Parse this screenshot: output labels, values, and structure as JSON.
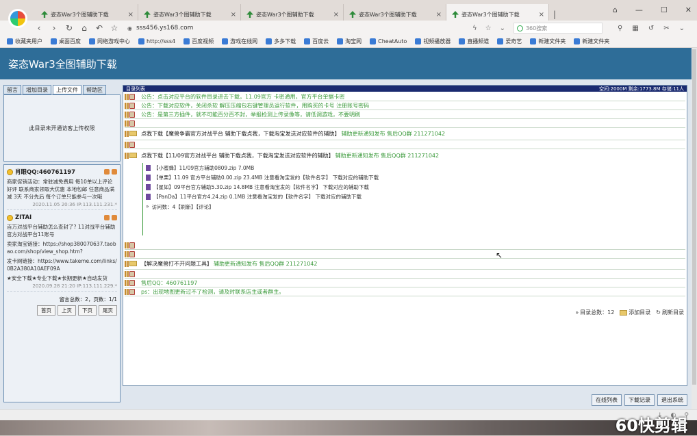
{
  "tabs": [
    {
      "label": "姿态War3个图辅助下载",
      "active": false
    },
    {
      "label": "姿态War3个图辅助下载",
      "active": false
    },
    {
      "label": "姿态War3个图辅助下载",
      "active": false
    },
    {
      "label": "姿态War3个图辅助下载",
      "active": false
    },
    {
      "label": "姿态War3个图辅助下载",
      "active": true
    }
  ],
  "url": "sss456.ys168.com",
  "search_engine": "360搜索",
  "bookmarks": [
    "收藏夹用户",
    "桌面百度",
    "网络游戏中心",
    "http://sss4",
    "百度视频",
    "游戏在线网",
    "多多下载",
    "百度云",
    "淘宝网",
    "CheatAuto",
    "视频播放器",
    "直播频道",
    "爱奇艺",
    "新建文件夹",
    "新建文件夹"
  ],
  "site_title": "姿态War3全图辅助下载",
  "left_tabs": [
    "留言",
    "增加目录",
    "上传文件",
    "帮助区"
  ],
  "no_upload_msg": "此目录未开通访客上传权限",
  "messages": [
    {
      "user": "肖眼QQ:460761197",
      "body": "商家促销活动：常驻减免费用 每10单以上评论好评 联系商家领取大优惠 本地包邮 任意商品满减 3天 不分先后 每个订单只能参与一次哦",
      "time": "2020.11.05 20:36 IP:113.111.231.*"
    },
    {
      "user": "ZITAI",
      "body": "百万对战平台辅助怎么查封了? 11对战平台辅助官方对战平台11账号",
      "sub": "卖家淘宝链接：https://shop380070637.taobao.com/shop/view_shop.htm?",
      "sub2": "发卡网链接：https://www.takeme.com/links/0B2A380A10AEF09A",
      "foot": "★安全下载★专业下载★长期更新★自动发货",
      "time": "2020.09.28 21:20 IP:113.111.229.*"
    }
  ],
  "pager": {
    "info": "留言总数：2，页数：1/1",
    "buttons": [
      "首页",
      "上页",
      "下页",
      "尾页"
    ]
  },
  "main_title": "目录列表",
  "quota": "空间:2000M 剩余:1773.8M 存储:11人",
  "notices": [
    "公告：点击对应平台的软件目录进去下载，11.09官方 卡密通用，官方平台单据卡密",
    "公告：下载对应软件，关闭杀软 解压压缩包右键管理员运行软件，用购买的卡号 注册账号密码",
    "公告：是第三方插件，就不可能百分百不封，举报检测上传录像等，请低调游戏，不要明刷"
  ],
  "folder1": {
    "name": "点我下载【魔兽争霸官方对战平台 辅助下载点我，下载淘宝发送对应软件的辅助】",
    "note": "辅助更新通知发布 售后QQ群 211271042"
  },
  "folder2": {
    "name": "点我下载【11/09官方对战平台 辅助下载点我，下载淘宝发送对应软件的辅助】",
    "note": "辅助更新通知发布 售后QQ群 211271042"
  },
  "files": [
    "【小蜜蜂】11/09官方辅助0809.zip 7.0MB",
    "【单栗】11.09 官方平台辅助0.00.zip 23.4MB 注意看淘宝发的【软件名字】 下载对应的辅助下载",
    "【星如】09平台官方辅助5.30.zip 14.8MB 注意看淘宝发的【软件名字】 下载对应的辅助下载",
    "【PanDa】11平台官方4.24.zip 0.1MB 注意看淘宝发的【软件名字】 下载对应的辅助下载"
  ],
  "file_actions": "访问数：4【刷新】【评论】",
  "folder3": {
    "name": "【解决魔兽打不开问题工具】",
    "note": "辅助更新通知发布 售后QQ群 211271042"
  },
  "contact": "售后QQ：460761197",
  "ps": "ps：出现地图更新过不了检测，请及时联系店主或者群主。",
  "summary": {
    "count": "目录总数：12",
    "add": "添加目录",
    "refresh": "刷新目录"
  },
  "footer_buttons": [
    "在线列表",
    "下载记录",
    "退出系统"
  ],
  "watermark": "60快剪辑"
}
